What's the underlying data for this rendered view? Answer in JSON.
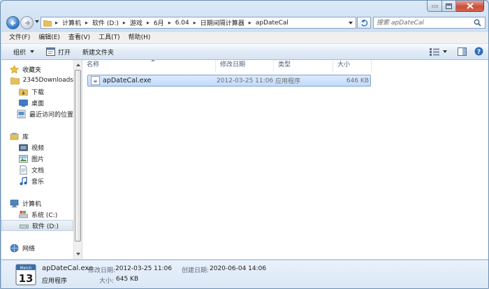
{
  "window": {
    "minimize_icon": "minimize-icon",
    "maximize_icon": "maximize-icon",
    "close_icon": "close-icon"
  },
  "address_bar": {
    "breadcrumb": [
      "计算机",
      "软件 (D:)",
      "游戏",
      "6月",
      "6.04",
      "日期间隔计算器",
      "apDateCal"
    ]
  },
  "search": {
    "placeholder": "搜索 apDateCal"
  },
  "menubar": {
    "items": [
      "文件(F)",
      "编辑(E)",
      "查看(V)",
      "工具(T)",
      "帮助(H)"
    ]
  },
  "commandbar": {
    "organize": "组织",
    "open": "打开",
    "new_folder": "新建文件夹"
  },
  "nav": {
    "favorites": {
      "label": "收藏夹",
      "items": [
        "2345Downloads",
        "下载",
        "桌面",
        "最近访问的位置"
      ]
    },
    "libraries": {
      "label": "库",
      "items": [
        "视频",
        "图片",
        "文档",
        "音乐"
      ]
    },
    "computer": {
      "label": "计算机",
      "items": [
        "系统 (C:)",
        "软件 (D:)"
      ]
    },
    "network": {
      "label": "网络"
    }
  },
  "file_list": {
    "columns": [
      "名称",
      "修改日期",
      "类型",
      "大小"
    ],
    "rows": [
      {
        "name": "apDateCal.exe",
        "modified": "2012-03-25 11:06",
        "type": "应用程序",
        "size": "646 KB"
      }
    ]
  },
  "details": {
    "icon_month": "March",
    "icon_day": "13",
    "filename": "apDateCal.exe",
    "filetype": "应用程序",
    "modified_label": "修改日期:",
    "modified_value": "2012-03-25 11:06",
    "created_label": "创建日期:",
    "created_value": "2020-06-04 14:06",
    "size_label": "大小:",
    "size_value": "645 KB"
  }
}
